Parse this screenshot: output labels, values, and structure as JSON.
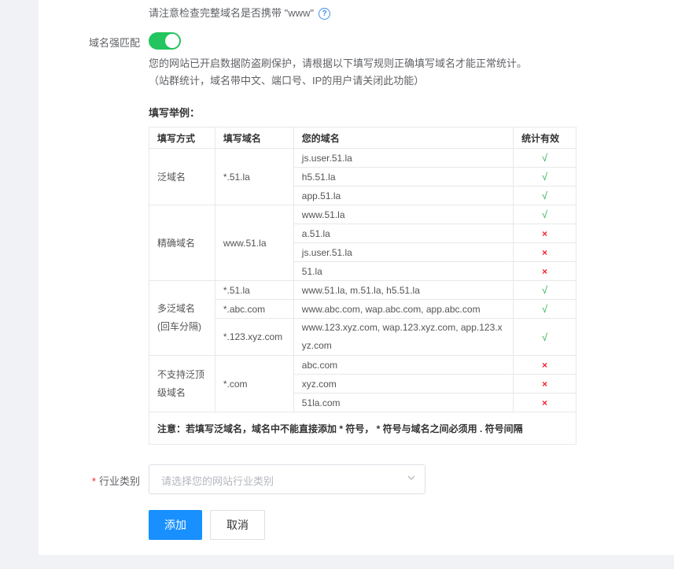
{
  "hint": {
    "text": "请注意检查完整域名是否携带 \"www\"",
    "icon": "question-circle-icon"
  },
  "strict_match": {
    "label": "域名强匹配",
    "enabled": true,
    "desc_line1": "您的网站已开启数据防盗刷保护，请根据以下填写规则正确填写域名才能正常统计。",
    "desc_line2": "（站群统计，域名带中文、端口号、IP的用户请关闭此功能）"
  },
  "example": {
    "title": "填写举例：",
    "headers": [
      "填写方式",
      "填写域名",
      "您的域名",
      "统计有效"
    ],
    "rows": {
      "r1": {
        "method": "泛域名",
        "pattern": "*.51.la",
        "d1": "js.user.51.la",
        "d2": "h5.51.la",
        "d3": "app.51.la"
      },
      "r2": {
        "method": "精确域名",
        "pattern": "www.51.la",
        "d1": "www.51.la",
        "d2": "a.51.la",
        "d3": "js.user.51.la",
        "d4": "51.la"
      },
      "r3": {
        "method_l1": "多泛域名",
        "method_l2": "(回车分隔)",
        "p1": "*.51.la",
        "p2": "*.abc.com",
        "p3": "*.123.xyz.com",
        "d1": "www.51.la, m.51.la, h5.51.la",
        "d2": "www.abc.com, wap.abc.com, app.abc.com",
        "d3_l1": "www.123.xyz.com, wap.123.xyz.com, app.123.x",
        "d3_l2": "yz.com"
      },
      "r4": {
        "method_l1": "不支持泛顶",
        "method_l2": "级域名",
        "pattern": "*.com",
        "d1": "abc.com",
        "d2": "xyz.com",
        "d3": "51la.com"
      }
    },
    "valid_mark": "√",
    "invalid_mark": "×",
    "note": "注意：若填写泛域名，域名中不能直接添加 * 符号， * 符号与域名之间必须用 . 符号间隔"
  },
  "industry": {
    "required_mark": "*",
    "label": "行业类别",
    "placeholder": "请选择您的网站行业类别"
  },
  "actions": {
    "submit": "添加",
    "cancel": "取消"
  },
  "colors": {
    "accent": "#1890ff",
    "switch_on": "#22c55e",
    "valid": "#22b34a",
    "invalid": "#f5222d"
  }
}
